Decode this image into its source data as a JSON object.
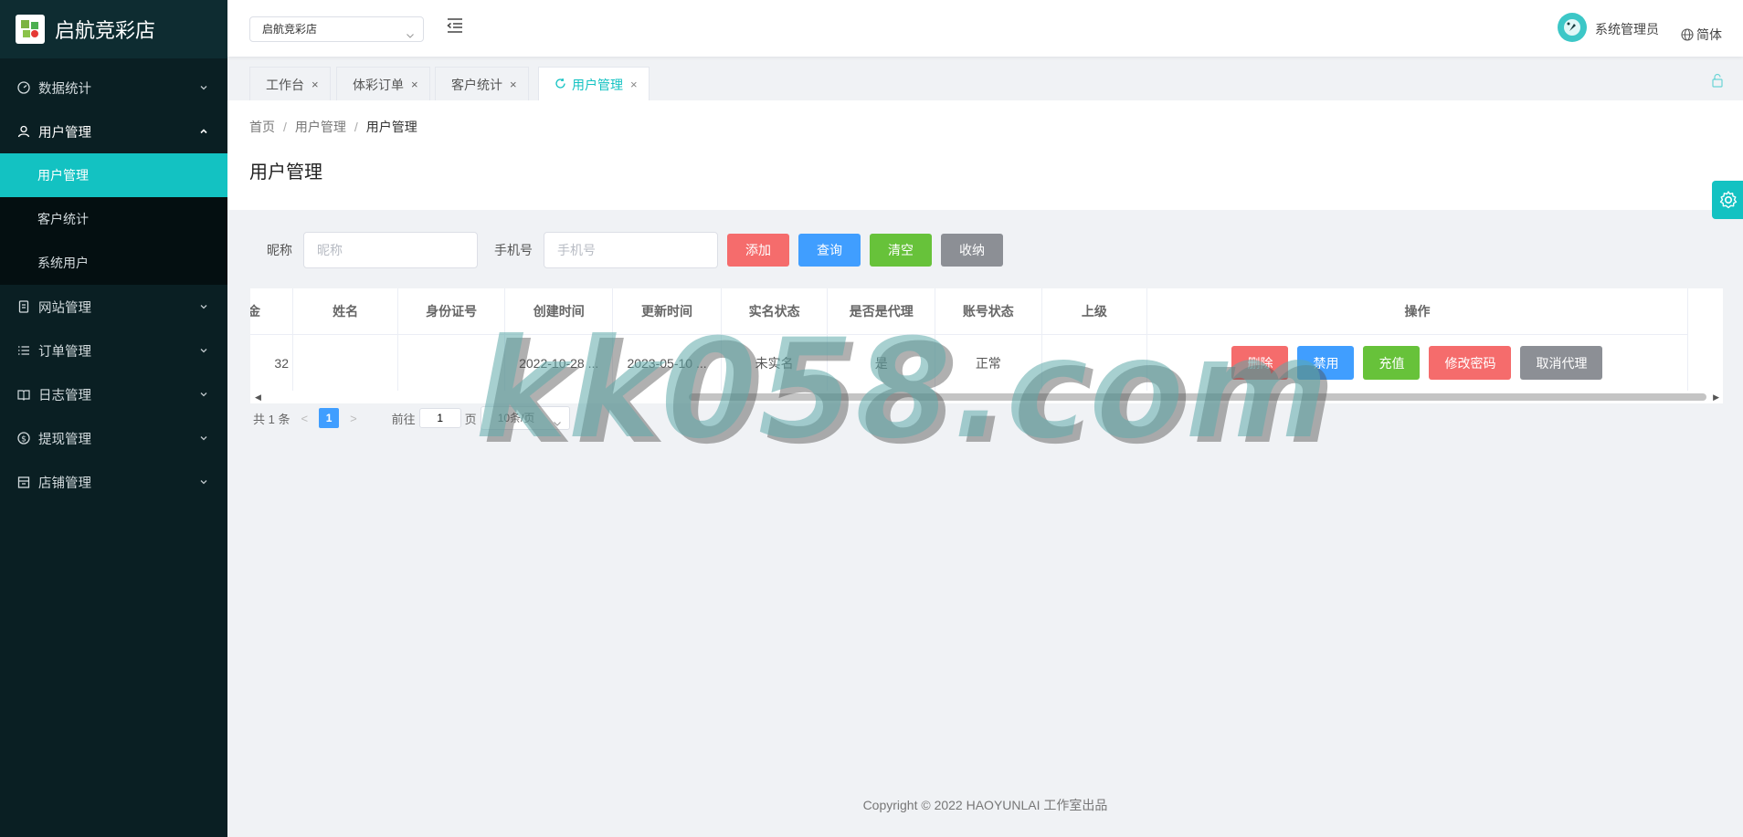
{
  "app": {
    "logo_text": "启航竞彩店"
  },
  "sidebar": {
    "items": [
      {
        "label": "数据统计",
        "icon": "dashboard-icon"
      },
      {
        "label": "用户管理",
        "icon": "user-icon"
      },
      {
        "label": "网站管理",
        "icon": "document-icon"
      },
      {
        "label": "订单管理",
        "icon": "list-icon"
      },
      {
        "label": "日志管理",
        "icon": "book-icon"
      },
      {
        "label": "提现管理",
        "icon": "coin-icon"
      },
      {
        "label": "店铺管理",
        "icon": "store-icon"
      }
    ],
    "subitems": [
      {
        "label": "用户管理",
        "active": true
      },
      {
        "label": "客户统计",
        "active": false
      },
      {
        "label": "系统用户",
        "active": false
      }
    ],
    "active_color": "#13c2c2"
  },
  "header": {
    "store_select": "启航竞彩店",
    "admin_name": "系统管理员",
    "language": "简体"
  },
  "tabs": [
    {
      "label": "工作台",
      "close": "×"
    },
    {
      "label": "体彩订单",
      "close": "×"
    },
    {
      "label": "客户统计",
      "close": "×"
    },
    {
      "label": "用户管理",
      "close": "×",
      "active": true
    }
  ],
  "breadcrumb": {
    "home": "首页",
    "level1": "用户管理",
    "level2": "用户管理",
    "separator": "/"
  },
  "page_title": "用户管理",
  "filters": {
    "nickname_label": "昵称",
    "nickname_placeholder": "昵称",
    "phone_label": "手机号",
    "phone_placeholder": "手机号",
    "add": "添加",
    "query": "查询",
    "clear": "清空",
    "collapse": "收纳"
  },
  "table": {
    "columns": [
      "金",
      "姓名",
      "身份证号",
      "创建时间",
      "更新时间",
      "实名状态",
      "是否是代理",
      "账号状态",
      "上级",
      "操作"
    ],
    "rows": [
      {
        "amount": "32",
        "name": "",
        "id_card": "",
        "created": "2022-10-28 ...",
        "updated": "2023-05-10 ...",
        "verified": "未实名",
        "is_agent": "是",
        "status": "正常",
        "parent": ""
      }
    ],
    "actions": {
      "delete": "删除",
      "ban": "禁用",
      "charge": "充值",
      "change_pwd": "修改密码",
      "cancel_agent": "取消代理"
    }
  },
  "pagination": {
    "total": "共 1 条",
    "current_page": "1",
    "goto_label": "前往",
    "goto_value": "1",
    "page_suffix": "页",
    "page_size": "10条/页"
  },
  "watermark": "kk058.com",
  "footer": "Copyright © 2022 HAOYUNLAI 工作室出品"
}
